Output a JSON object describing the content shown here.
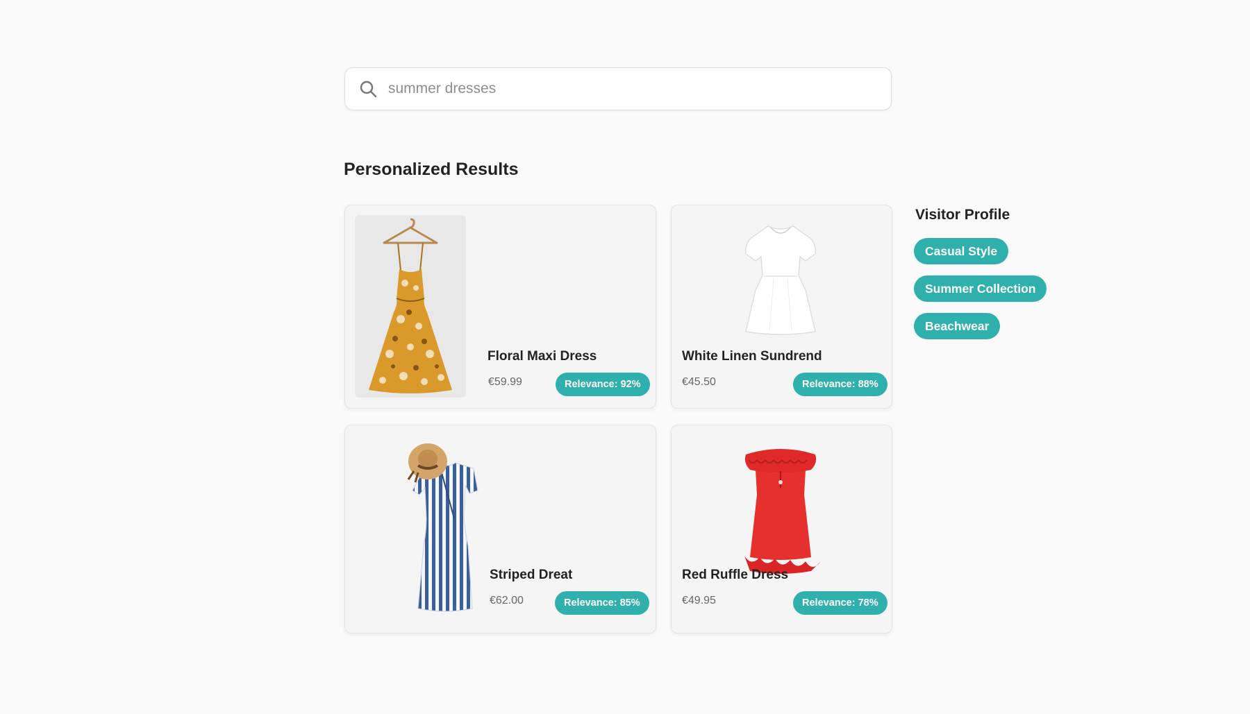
{
  "search": {
    "placeholder": "summer dresses",
    "icon": "search-icon"
  },
  "section_title": "Personalized Results",
  "products": [
    {
      "name": "Floral Maxi Dress",
      "price": "€59.99",
      "relevance": "Relevance: 92%",
      "relevance_value": 0.92,
      "image": "floral-maxi-dress-on-hanger"
    },
    {
      "name": "White Linen Sundrend",
      "price": "€45.50",
      "relevance": "Relevance: 88%",
      "relevance_value": 0.88,
      "image": "white-linen-dress"
    },
    {
      "name": "Striped Dreat",
      "price": "€62.00",
      "relevance": "Relevance: 85%",
      "relevance_value": 0.85,
      "image": "striped-wrap-dress-with-straw-hat"
    },
    {
      "name": "Red Ruffle Dress",
      "price": "€49.95",
      "relevance": "Relevance: 78%",
      "relevance_value": 0.78,
      "image": "red-ruffle-dress"
    }
  ],
  "visitor_profile": {
    "title": "Visitor Profile",
    "tags": [
      "Casual Style",
      "Summer Collection",
      "Beachwear"
    ]
  },
  "colors": {
    "accent": "#2fb0ad",
    "background": "#fafafa",
    "card": "#f5f5f5"
  }
}
